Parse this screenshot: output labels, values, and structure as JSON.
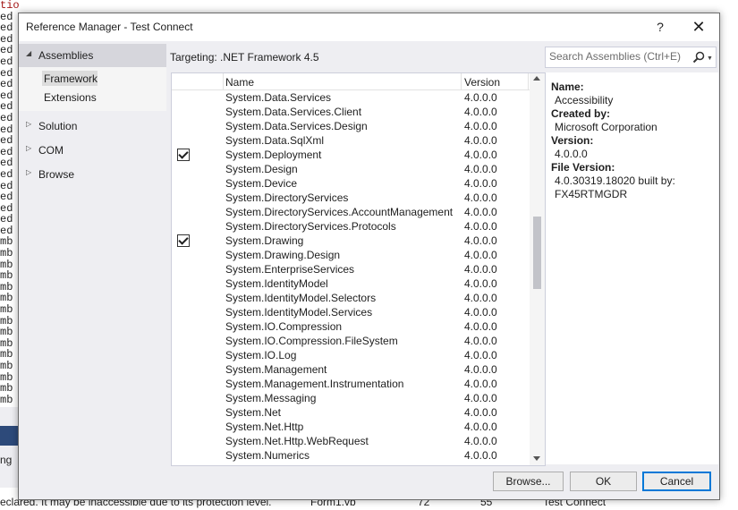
{
  "background": {
    "code_fragments": [
      "tion\"",
      "ed",
      "ed",
      "ed",
      "ed",
      "ed",
      "ed",
      "ed",
      "ed",
      "ed",
      "ed",
      "ed",
      "ed",
      "ed",
      "ed",
      "ed",
      "ed",
      "ed",
      "ed",
      "ed",
      "ed",
      "mb",
      "mb",
      "mb",
      "mb",
      "mb",
      "mb",
      "mb",
      "mb",
      "mb",
      "mb",
      "mb",
      "mb",
      "mb",
      "mb",
      "mb"
    ],
    "tab_text": "ng",
    "error_row": {
      "description": "eclared. It may be inaccessible due to its protection level.",
      "file": "Form1.vb",
      "line": "72",
      "column": "55",
      "project": "Test Connect"
    }
  },
  "dialog": {
    "title": "Reference Manager - Test Connect",
    "help_label": "?",
    "close_label": "✕"
  },
  "nav": {
    "assemblies": "Assemblies",
    "framework": "Framework",
    "extensions": "Extensions",
    "solution": "Solution",
    "com": "COM",
    "browse": "Browse"
  },
  "targeting": "Targeting: .NET Framework 4.5",
  "search": {
    "placeholder": "Search Assemblies (Ctrl+E)"
  },
  "grid": {
    "columns": {
      "name": "Name",
      "version": "Version"
    },
    "rows": [
      {
        "name": "System.Data.Services",
        "version": "4.0.0.0",
        "checked": false
      },
      {
        "name": "System.Data.Services.Client",
        "version": "4.0.0.0",
        "checked": false
      },
      {
        "name": "System.Data.Services.Design",
        "version": "4.0.0.0",
        "checked": false
      },
      {
        "name": "System.Data.SqlXml",
        "version": "4.0.0.0",
        "checked": false
      },
      {
        "name": "System.Deployment",
        "version": "4.0.0.0",
        "checked": true
      },
      {
        "name": "System.Design",
        "version": "4.0.0.0",
        "checked": false
      },
      {
        "name": "System.Device",
        "version": "4.0.0.0",
        "checked": false
      },
      {
        "name": "System.DirectoryServices",
        "version": "4.0.0.0",
        "checked": false
      },
      {
        "name": "System.DirectoryServices.AccountManagement",
        "version": "4.0.0.0",
        "checked": false
      },
      {
        "name": "System.DirectoryServices.Protocols",
        "version": "4.0.0.0",
        "checked": false
      },
      {
        "name": "System.Drawing",
        "version": "4.0.0.0",
        "checked": true
      },
      {
        "name": "System.Drawing.Design",
        "version": "4.0.0.0",
        "checked": false
      },
      {
        "name": "System.EnterpriseServices",
        "version": "4.0.0.0",
        "checked": false
      },
      {
        "name": "System.IdentityModel",
        "version": "4.0.0.0",
        "checked": false
      },
      {
        "name": "System.IdentityModel.Selectors",
        "version": "4.0.0.0",
        "checked": false
      },
      {
        "name": "System.IdentityModel.Services",
        "version": "4.0.0.0",
        "checked": false
      },
      {
        "name": "System.IO.Compression",
        "version": "4.0.0.0",
        "checked": false
      },
      {
        "name": "System.IO.Compression.FileSystem",
        "version": "4.0.0.0",
        "checked": false
      },
      {
        "name": "System.IO.Log",
        "version": "4.0.0.0",
        "checked": false
      },
      {
        "name": "System.Management",
        "version": "4.0.0.0",
        "checked": false
      },
      {
        "name": "System.Management.Instrumentation",
        "version": "4.0.0.0",
        "checked": false
      },
      {
        "name": "System.Messaging",
        "version": "4.0.0.0",
        "checked": false
      },
      {
        "name": "System.Net",
        "version": "4.0.0.0",
        "checked": false
      },
      {
        "name": "System.Net.Http",
        "version": "4.0.0.0",
        "checked": false
      },
      {
        "name": "System.Net.Http.WebRequest",
        "version": "4.0.0.0",
        "checked": false
      },
      {
        "name": "System.Numerics",
        "version": "4.0.0.0",
        "checked": false
      }
    ]
  },
  "details": {
    "name_label": "Name:",
    "name_value": "Accessibility",
    "created_by_label": "Created by:",
    "created_by_value": "Microsoft Corporation",
    "version_label": "Version:",
    "version_value": "4.0.0.0",
    "file_version_label": "File Version:",
    "file_version_line1": "4.0.30319.18020 built by:",
    "file_version_line2": "FX45RTMGDR"
  },
  "footer": {
    "browse": "Browse...",
    "ok": "OK",
    "cancel": "Cancel"
  }
}
